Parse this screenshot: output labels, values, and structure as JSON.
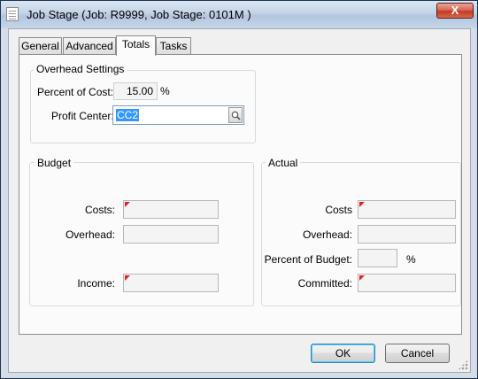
{
  "window": {
    "title": "Job Stage (Job: R9999, Job Stage: 0101M )",
    "close_label": "X"
  },
  "tabs": [
    {
      "label": "General",
      "active": false
    },
    {
      "label": "Advanced",
      "active": false
    },
    {
      "label": "Totals",
      "active": true
    },
    {
      "label": "Tasks",
      "active": false
    }
  ],
  "overhead_settings": {
    "group_label": "Overhead Settings",
    "percent_of_cost_label": "Percent of Cost:",
    "percent_of_cost_value": "15.00",
    "percent_unit": "%",
    "profit_center_label": "Profit Center:",
    "profit_center_value": "CC2"
  },
  "budget": {
    "group_label": "Budget",
    "costs_label": "Costs:",
    "overhead_label": "Overhead:",
    "income_label": "Income:"
  },
  "actual": {
    "group_label": "Actual",
    "costs_label": "Costs",
    "overhead_label": "Overhead:",
    "percent_of_budget_label": "Percent of Budget:",
    "percent_unit": "%",
    "committed_label": "Committed:"
  },
  "buttons": {
    "ok_label": "OK",
    "cancel_label": "Cancel"
  },
  "colors": {
    "required_flag": "#e0231f",
    "selection": "#3399ff",
    "close_button": "#c23a22"
  }
}
